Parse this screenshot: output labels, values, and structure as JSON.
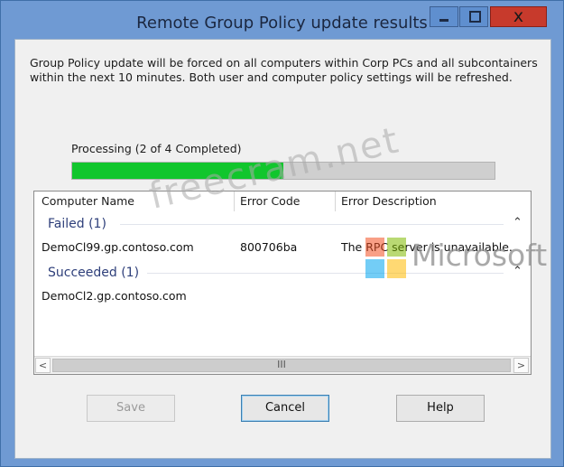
{
  "window": {
    "title": "Remote Group Policy update results",
    "close_glyph": "x"
  },
  "description": "Group Policy update will be forced on all computers within Corp PCs and all subcontainers\nwithin the next 10 minutes. Both user and computer policy settings will be refreshed.",
  "progress": {
    "label": "Processing (2 of 4 Completed)",
    "completed": 2,
    "total": 4
  },
  "list": {
    "columns": [
      "Computer Name",
      "Error Code",
      "Error Description"
    ],
    "groups": [
      {
        "label": "Failed (1)",
        "rows": [
          {
            "computer": "DemoCl99.gp.contoso.com",
            "error_code": "800706ba",
            "error_description": "The RPC server is unavailable."
          }
        ]
      },
      {
        "label": "Succeeded (1)",
        "rows": [
          {
            "computer": "DemoCl2.gp.contoso.com",
            "error_code": "",
            "error_description": ""
          }
        ]
      }
    ],
    "scrollbar_grip": "III"
  },
  "buttons": {
    "save": "Save",
    "cancel": "Cancel",
    "help": "Help"
  },
  "overlay": {
    "watermark": "freecram.net",
    "brand_text": "Microsoft"
  },
  "colors": {
    "title_bar": "#6f9ad3",
    "close_button": "#c73a2c",
    "progress_fill": "#11c62d",
    "group_header": "#2e3f7a"
  },
  "icons": {
    "minimize": "minimize-icon",
    "maximize": "maximize-icon",
    "close": "close-icon",
    "collapse": "chevron-up-icon"
  }
}
